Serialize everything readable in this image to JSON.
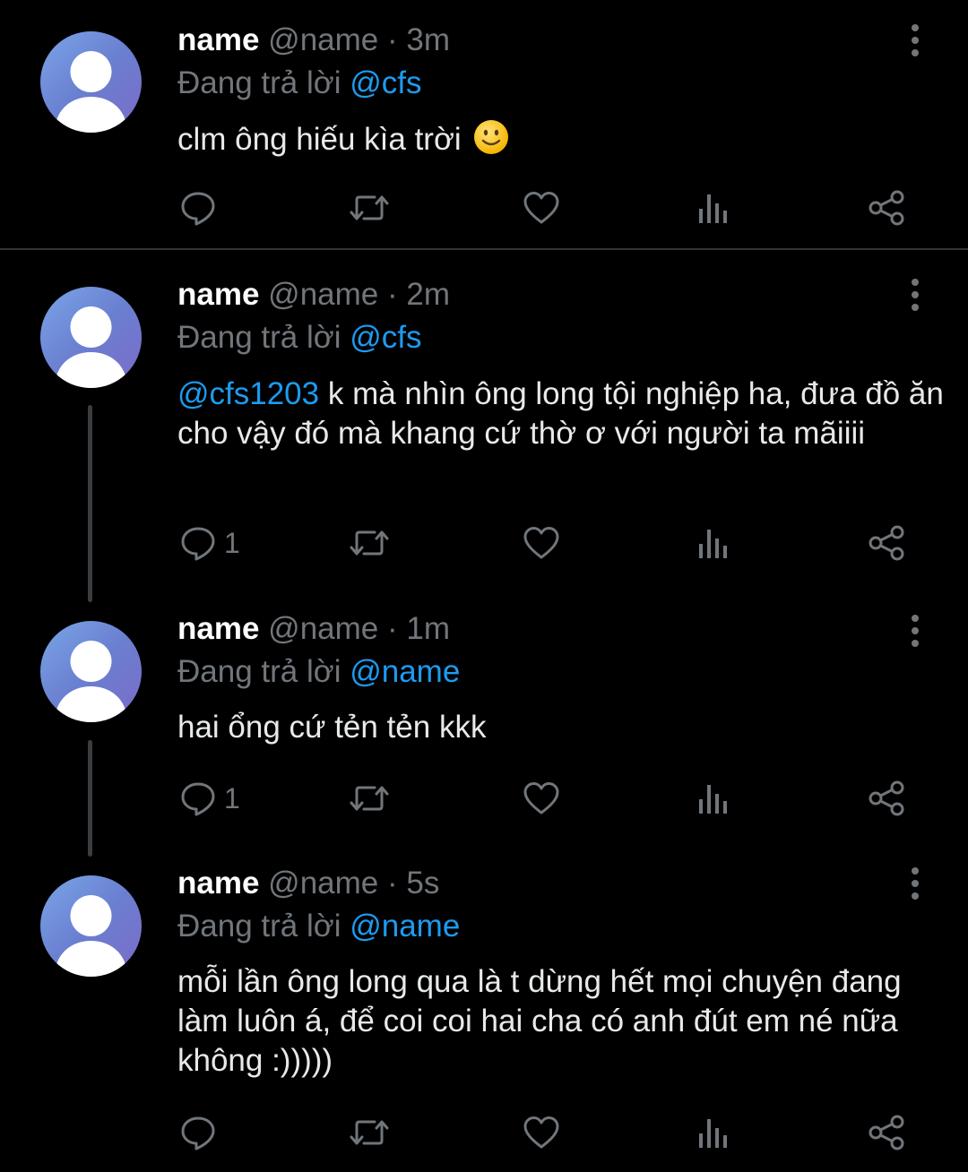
{
  "tweets": [
    {
      "name": "name",
      "handle": "@name",
      "dot": "·",
      "time": "3m",
      "replying_prefix": "Đang trả lời",
      "replying_to": "@cfs",
      "text": "clm ông hiếu kìa trời",
      "emoji": "slightly-smiling-face",
      "reply_count": "",
      "retweet_count": "",
      "like_count": ""
    },
    {
      "name": "name",
      "handle": "@name",
      "dot": "·",
      "time": "2m",
      "replying_prefix": "Đang trả lời",
      "replying_to": "@cfs",
      "mention": "@cfs1203",
      "text": " k mà nhìn ông long tội nghiệp ha, đưa đồ ăn cho vậy đó mà khang cứ thờ ơ với người ta mãiiii",
      "reply_count": "1",
      "retweet_count": "",
      "like_count": ""
    },
    {
      "name": "name",
      "handle": "@name",
      "dot": "·",
      "time": "1m",
      "replying_prefix": "Đang trả lời",
      "replying_to": "@name",
      "text": "hai ổng cứ tẻn tẻn kkk",
      "reply_count": "1",
      "retweet_count": "",
      "like_count": ""
    },
    {
      "name": "name",
      "handle": "@name",
      "dot": "·",
      "time": "5s",
      "replying_prefix": "Đang trả lời",
      "replying_to": "@name",
      "text": "mỗi lần ông long qua là t dừng hết mọi chuyện đang làm luôn á, để coi coi hai cha có anh đút em né nữa không :)))))",
      "reply_count": "",
      "retweet_count": "",
      "like_count": ""
    }
  ],
  "icons": {
    "reply": "reply-icon",
    "retweet": "retweet-icon",
    "like": "heart-icon",
    "views": "views-icon",
    "share": "share-icon",
    "more": "more-options-icon"
  },
  "colors": {
    "background": "#000000",
    "text": "#e7e9ea",
    "muted": "#71767b",
    "accent": "#1d9bf0",
    "divider": "#2f3336"
  }
}
